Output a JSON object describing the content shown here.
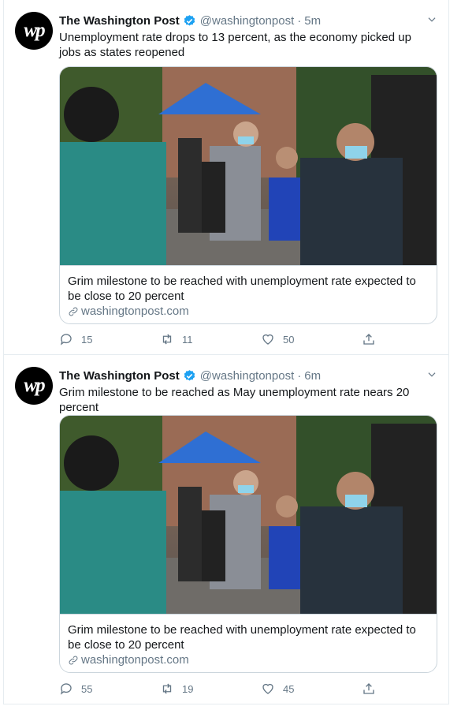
{
  "tweets": [
    {
      "name": "The Washington Post",
      "handle": "@washingtonpost",
      "dot": "·",
      "time": "5m",
      "avatar_text": "wp",
      "text": "Unemployment rate drops to 13 percent, as the economy picked up jobs as states reopened",
      "card": {
        "title": "Grim milestone to be reached with unemployment rate expected to be close to 20 percent",
        "domain": "washingtonpost.com"
      },
      "counts": {
        "replies": "15",
        "retweets": "11",
        "likes": "50"
      }
    },
    {
      "name": "The Washington Post",
      "handle": "@washingtonpost",
      "dot": "·",
      "time": "6m",
      "avatar_text": "wp",
      "text": "Grim milestone to be reached as May unemployment rate nears 20 percent",
      "card": {
        "title": "Grim milestone to be reached with unemployment rate expected to be close to 20 percent",
        "domain": "washingtonpost.com"
      },
      "counts": {
        "replies": "55",
        "retweets": "19",
        "likes": "45"
      }
    }
  ],
  "colors": {
    "verified": "#1da1f2",
    "secondary_text": "#657786",
    "border": "#e6ecf0"
  },
  "icons": [
    "verified-badge-icon",
    "chevron-down-icon",
    "link-icon",
    "reply-icon",
    "retweet-icon",
    "like-icon",
    "share-icon"
  ]
}
